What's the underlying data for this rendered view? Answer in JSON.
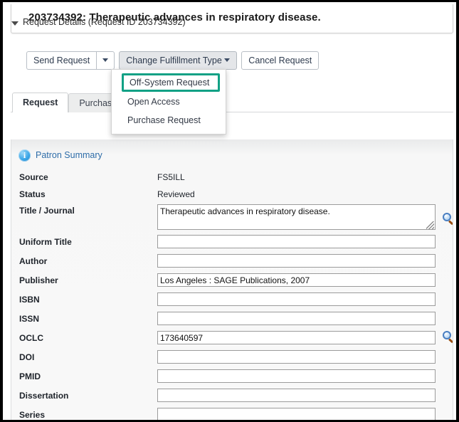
{
  "window": {
    "title": "203734392: Therapeutic advances in respiratory disease."
  },
  "toolbar": {
    "send_request_label": "Send Request",
    "send_request_toggle_name": "send-request-dropdown-toggle",
    "change_fulfillment_label": "Change Fulfillment Type",
    "cancel_request_label": "Cancel Request"
  },
  "dropdown": {
    "open": true,
    "highlight_color": "#11a185",
    "items": [
      {
        "label": "Off-System Request",
        "selected": true
      },
      {
        "label": "Open Access",
        "selected": false
      },
      {
        "label": "Purchase Request",
        "selected": false
      }
    ]
  },
  "tabs": [
    {
      "label": "Request",
      "active": true
    },
    {
      "label": "Purchase",
      "active": false
    }
  ],
  "details": {
    "section_label": "Request Details (Request ID 203734392)",
    "expanded": true
  },
  "patron": {
    "link_label": "Patron Summary",
    "icon": "info-icon",
    "link_color": "#2d6ca8"
  },
  "form": {
    "readonly_fields": [
      {
        "label": "Source",
        "value": "FS5ILL"
      },
      {
        "label": "Status",
        "value": "Reviewed"
      }
    ],
    "fields": [
      {
        "label": "Title / Journal",
        "value": "Therapeutic advances in respiratory disease.",
        "type": "textarea",
        "magnifier": true
      },
      {
        "label": "Uniform Title",
        "value": "",
        "type": "input",
        "magnifier": false
      },
      {
        "label": "Author",
        "value": "",
        "type": "input",
        "magnifier": false
      },
      {
        "label": "Publisher",
        "value": "Los Angeles : SAGE Publications, 2007",
        "type": "input",
        "magnifier": false
      },
      {
        "label": "ISBN",
        "value": "",
        "type": "input",
        "magnifier": false
      },
      {
        "label": "ISSN",
        "value": "",
        "type": "input",
        "magnifier": false
      },
      {
        "label": "OCLC",
        "value": "173640597",
        "type": "input",
        "magnifier": true
      },
      {
        "label": "DOI",
        "value": "",
        "type": "input",
        "magnifier": false
      },
      {
        "label": "PMID",
        "value": "",
        "type": "input",
        "magnifier": false
      },
      {
        "label": "Dissertation",
        "value": "",
        "type": "input",
        "magnifier": false
      },
      {
        "label": "Series",
        "value": "",
        "type": "input",
        "magnifier": false
      }
    ]
  }
}
